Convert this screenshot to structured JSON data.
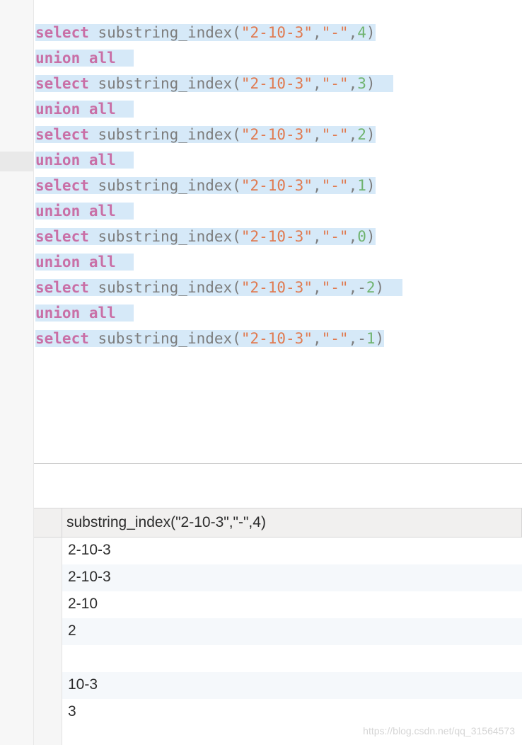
{
  "sql": {
    "lines": [
      {
        "parts": [
          {
            "t": "select",
            "c": "kw",
            "sel": true
          },
          {
            "t": " ",
            "c": "",
            "sel": true
          },
          {
            "t": "substring_index",
            "c": "fn",
            "sel": true
          },
          {
            "t": "(",
            "c": "paren",
            "sel": true
          },
          {
            "t": "\"2-10-3\"",
            "c": "str",
            "sel": true
          },
          {
            "t": ",",
            "c": "op",
            "sel": true
          },
          {
            "t": "\"-\"",
            "c": "str",
            "sel": true
          },
          {
            "t": ",",
            "c": "op",
            "sel": true
          },
          {
            "t": "4",
            "c": "num",
            "sel": true
          },
          {
            "t": ")",
            "c": "paren",
            "sel": true
          }
        ]
      },
      {
        "parts": [
          {
            "t": "union",
            "c": "kw",
            "sel": true
          },
          {
            "t": " ",
            "c": "",
            "sel": true
          },
          {
            "t": "all",
            "c": "kw",
            "sel": true
          },
          {
            "t": "  ",
            "c": "",
            "sel": true
          }
        ]
      },
      {
        "parts": [
          {
            "t": "select",
            "c": "kw",
            "sel": true
          },
          {
            "t": " ",
            "c": "",
            "sel": true
          },
          {
            "t": "substring_index",
            "c": "fn",
            "sel": true
          },
          {
            "t": "(",
            "c": "paren",
            "sel": true
          },
          {
            "t": "\"2-10-3\"",
            "c": "str",
            "sel": true
          },
          {
            "t": ",",
            "c": "op",
            "sel": true
          },
          {
            "t": "\"-\"",
            "c": "str",
            "sel": true
          },
          {
            "t": ",",
            "c": "op",
            "sel": true
          },
          {
            "t": "3",
            "c": "num",
            "sel": true
          },
          {
            "t": ")",
            "c": "paren",
            "sel": true
          },
          {
            "t": "  ",
            "c": "",
            "sel": true
          }
        ]
      },
      {
        "parts": [
          {
            "t": "union",
            "c": "kw",
            "sel": true
          },
          {
            "t": " ",
            "c": "",
            "sel": true
          },
          {
            "t": "all",
            "c": "kw",
            "sel": true
          },
          {
            "t": "  ",
            "c": "",
            "sel": true
          }
        ]
      },
      {
        "parts": [
          {
            "t": "select",
            "c": "kw",
            "sel": true
          },
          {
            "t": " ",
            "c": "",
            "sel": true
          },
          {
            "t": "substring_index",
            "c": "fn",
            "sel": true
          },
          {
            "t": "(",
            "c": "paren",
            "sel": true
          },
          {
            "t": "\"2-10-3\"",
            "c": "str",
            "sel": true
          },
          {
            "t": ",",
            "c": "op",
            "sel": true
          },
          {
            "t": "\"-\"",
            "c": "str",
            "sel": true
          },
          {
            "t": ",",
            "c": "op",
            "sel": true
          },
          {
            "t": "2",
            "c": "num",
            "sel": true
          },
          {
            "t": ")",
            "c": "paren",
            "sel": true
          }
        ]
      },
      {
        "parts": [
          {
            "t": "union",
            "c": "kw",
            "sel": true
          },
          {
            "t": " ",
            "c": "",
            "sel": true
          },
          {
            "t": "all",
            "c": "kw",
            "sel": true
          },
          {
            "t": "  ",
            "c": "",
            "sel": true
          }
        ]
      },
      {
        "parts": [
          {
            "t": "select",
            "c": "kw",
            "sel": true
          },
          {
            "t": " ",
            "c": "",
            "sel": true
          },
          {
            "t": "substring_index",
            "c": "fn",
            "sel": true
          },
          {
            "t": "(",
            "c": "paren",
            "sel": true
          },
          {
            "t": "\"2-10-3\"",
            "c": "str",
            "sel": true
          },
          {
            "t": ",",
            "c": "op",
            "sel": true
          },
          {
            "t": "\"-\"",
            "c": "str",
            "sel": true
          },
          {
            "t": ",",
            "c": "op",
            "sel": true
          },
          {
            "t": "1",
            "c": "num",
            "sel": true
          },
          {
            "t": ")",
            "c": "paren",
            "sel": true
          }
        ]
      },
      {
        "parts": [
          {
            "t": "union",
            "c": "kw",
            "sel": true
          },
          {
            "t": " ",
            "c": "",
            "sel": true
          },
          {
            "t": "all",
            "c": "kw",
            "sel": true
          },
          {
            "t": "  ",
            "c": "",
            "sel": true
          }
        ]
      },
      {
        "parts": [
          {
            "t": "select",
            "c": "kw",
            "sel": true
          },
          {
            "t": " ",
            "c": "",
            "sel": true
          },
          {
            "t": "substring_index",
            "c": "fn",
            "sel": true
          },
          {
            "t": "(",
            "c": "paren",
            "sel": true
          },
          {
            "t": "\"2-10-3\"",
            "c": "str",
            "sel": true
          },
          {
            "t": ",",
            "c": "op",
            "sel": true
          },
          {
            "t": "\"-\"",
            "c": "str",
            "sel": true
          },
          {
            "t": ",",
            "c": "op",
            "sel": true
          },
          {
            "t": "0",
            "c": "num",
            "sel": true
          },
          {
            "t": ")",
            "c": "paren",
            "sel": true
          }
        ]
      },
      {
        "parts": [
          {
            "t": "union",
            "c": "kw",
            "sel": true
          },
          {
            "t": " ",
            "c": "",
            "sel": true
          },
          {
            "t": "all",
            "c": "kw",
            "sel": true
          },
          {
            "t": "  ",
            "c": "",
            "sel": true
          }
        ]
      },
      {
        "parts": [
          {
            "t": "select",
            "c": "kw",
            "sel": true
          },
          {
            "t": " ",
            "c": "",
            "sel": true
          },
          {
            "t": "substring_index",
            "c": "fn",
            "sel": true
          },
          {
            "t": "(",
            "c": "paren",
            "sel": true
          },
          {
            "t": "\"2-10-3\"",
            "c": "str",
            "sel": true
          },
          {
            "t": ",",
            "c": "op",
            "sel": true
          },
          {
            "t": "\"-\"",
            "c": "str",
            "sel": true
          },
          {
            "t": ",",
            "c": "op",
            "sel": true
          },
          {
            "t": "-",
            "c": "op",
            "sel": true
          },
          {
            "t": "2",
            "c": "num",
            "sel": true
          },
          {
            "t": ")",
            "c": "paren",
            "sel": true
          },
          {
            "t": "  ",
            "c": "",
            "sel": true
          }
        ]
      },
      {
        "parts": [
          {
            "t": "union",
            "c": "kw",
            "sel": true
          },
          {
            "t": " ",
            "c": "",
            "sel": true
          },
          {
            "t": "all",
            "c": "kw",
            "sel": true
          },
          {
            "t": "  ",
            "c": "",
            "sel": true
          }
        ]
      },
      {
        "parts": [
          {
            "t": "select",
            "c": "kw",
            "sel": true
          },
          {
            "t": " ",
            "c": "",
            "sel": true
          },
          {
            "t": "substring_index",
            "c": "fn",
            "sel": true
          },
          {
            "t": "(",
            "c": "paren",
            "sel": true
          },
          {
            "t": "\"2-10-3\"",
            "c": "str",
            "sel": true
          },
          {
            "t": ",",
            "c": "op",
            "sel": true
          },
          {
            "t": "\"-\"",
            "c": "str",
            "sel": true
          },
          {
            "t": ",",
            "c": "op",
            "sel": true
          },
          {
            "t": "-",
            "c": "op",
            "sel": true
          },
          {
            "t": "1",
            "c": "num",
            "sel": true
          },
          {
            "t": ")",
            "c": "paren",
            "sel": true
          }
        ]
      }
    ]
  },
  "results": {
    "column": "substring_index(\"2-10-3\",\"-\",4)",
    "rows": [
      "2-10-3",
      "2-10-3",
      "2-10",
      "2",
      "",
      "10-3",
      "3"
    ]
  },
  "watermark": "https://blog.csdn.net/qq_31564573"
}
